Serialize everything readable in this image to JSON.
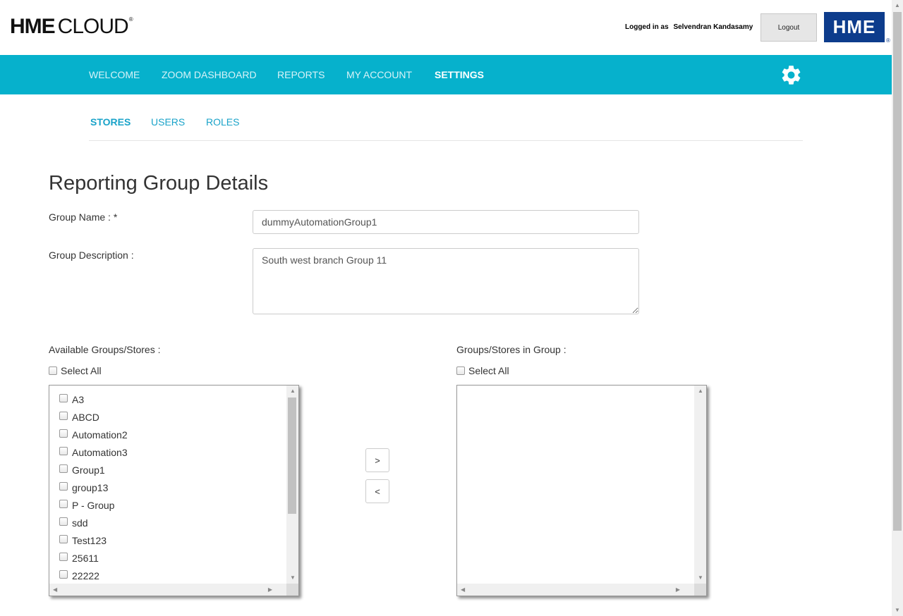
{
  "header": {
    "logo_bold": "HME",
    "logo_light": "CLOUD",
    "logo_reg": "®",
    "logged_in_label": "Logged in as",
    "user_name": "Selvendran Kandasamy",
    "logout_label": "Logout",
    "brand_badge": "HME",
    "brand_badge_reg": "®"
  },
  "nav": {
    "items": [
      "WELCOME",
      "ZOOM DASHBOARD",
      "REPORTS",
      "MY ACCOUNT",
      "SETTINGS"
    ],
    "active": "SETTINGS",
    "settings_icon": "gear-icon"
  },
  "subnav": {
    "items": [
      "STORES",
      "USERS",
      "ROLES"
    ],
    "active": "STORES"
  },
  "form": {
    "title": "Reporting Group Details",
    "group_name_label": "Group Name : *",
    "group_name_value": "dummyAutomationGroup1",
    "group_description_label": "Group Description :",
    "group_description_value": "South west branch Group 11"
  },
  "available": {
    "label": "Available Groups/Stores :",
    "select_all": "Select All",
    "items": [
      "A3",
      "ABCD",
      "Automation2",
      "Automation3",
      "Group1",
      "group13",
      "P - Group",
      "sdd",
      "Test123",
      "25611",
      "22222"
    ]
  },
  "in_group": {
    "label": "Groups/Stores in Group :",
    "select_all": "Select All",
    "items": []
  },
  "buttons": {
    "add": ">",
    "remove": "<"
  },
  "colors": {
    "nav_bg": "#06b1cc",
    "brand_blue": "#0d3c8c",
    "link": "#1aa3c9"
  }
}
